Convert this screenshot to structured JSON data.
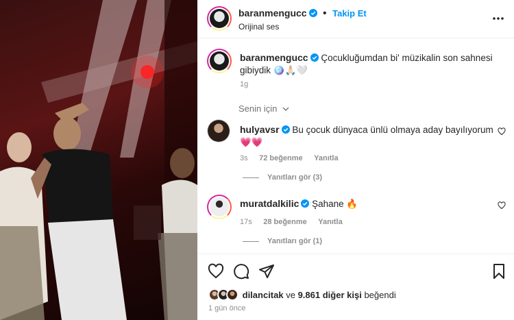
{
  "header": {
    "username": "baranmengucc",
    "follow_label": "Takip Et",
    "audio": "Orijinal ses"
  },
  "caption": {
    "username": "baranmengucc",
    "text": "Çocukluğumdan bi' müzikalin son sahnesi gibiydik 🪩🙏🏻🤍",
    "age": "1g"
  },
  "filter": {
    "label": "Senin için"
  },
  "comments": [
    {
      "username": "hulyavsr",
      "text": "Bu çocuk dünyaca ünlü olmaya aday bayılıyorum 💗💗",
      "age": "3s",
      "likes": "72 beğenme",
      "reply_label": "Yanıtla",
      "view_replies": "Yanıtları gör (3)"
    },
    {
      "username": "muratdalkilic",
      "text": "Şahane 🔥",
      "age": "17s",
      "likes": "28 beğenme",
      "reply_label": "Yanıtla",
      "view_replies": "Yanıtları gör (1)"
    }
  ],
  "likes": {
    "user": "dilancitak",
    "connector": "ve",
    "others": "9.861 diğer kişi",
    "suffix": "beğendi"
  },
  "posted": "1 gün önce",
  "colors": {
    "accent": "#0095f6",
    "verified": "#0095f6",
    "text": "#262626",
    "muted": "#8e8e8e"
  }
}
